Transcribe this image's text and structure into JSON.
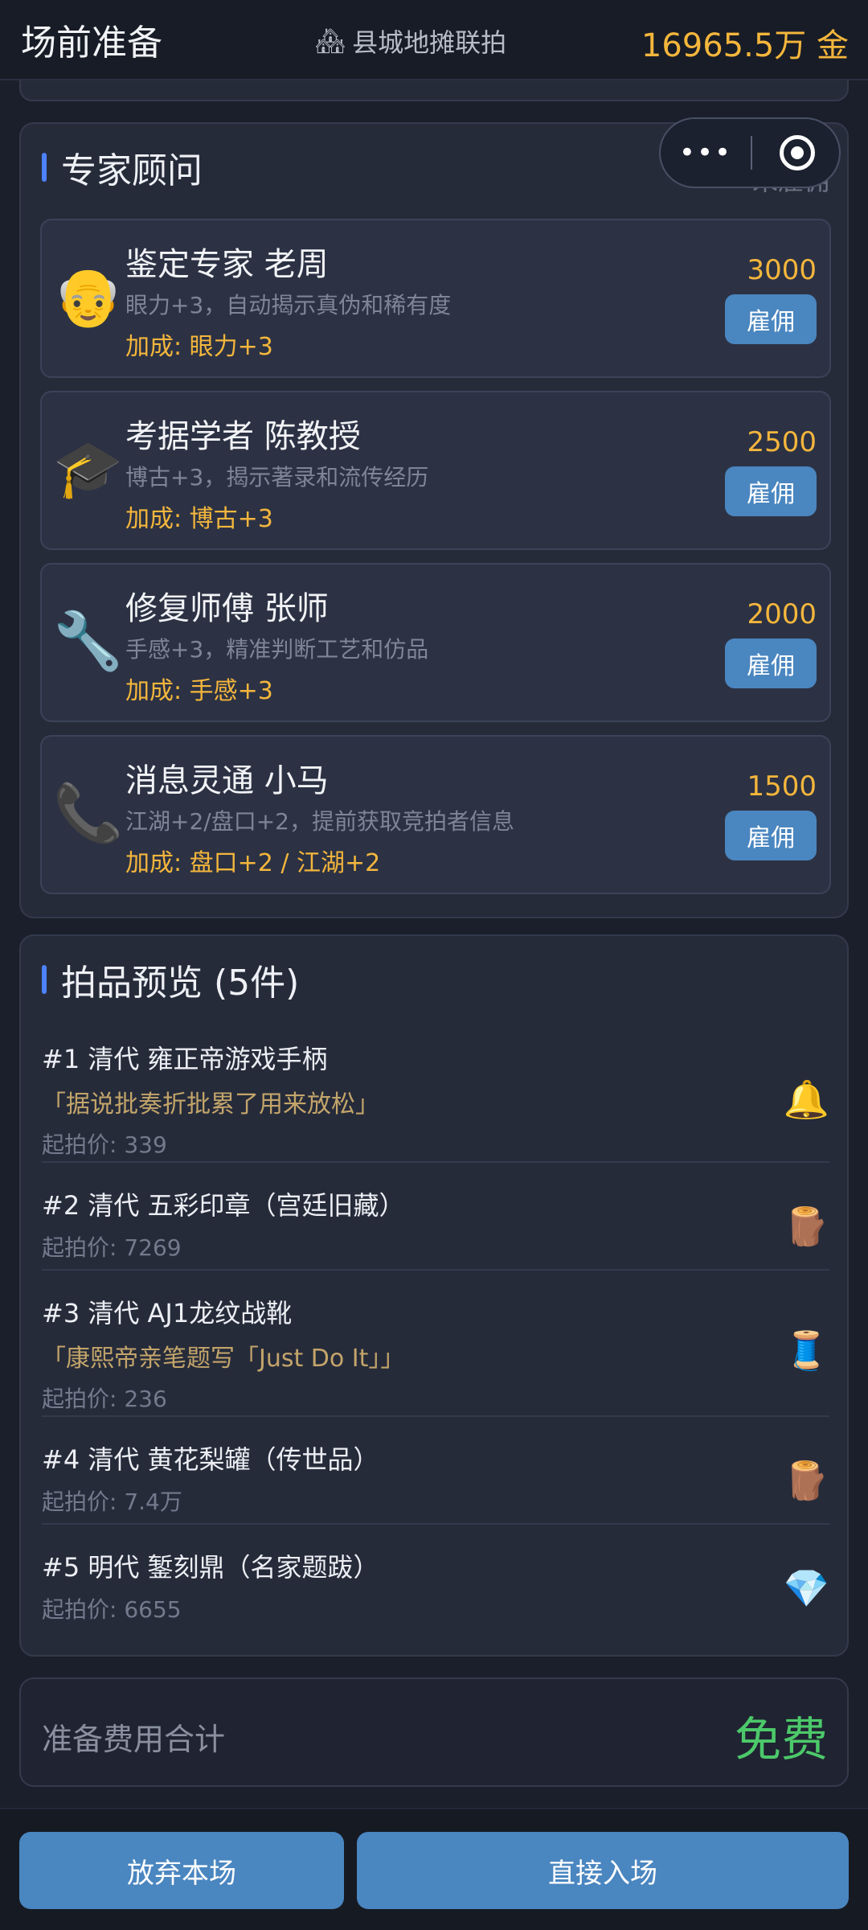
{
  "header": {
    "title": "场前准备",
    "location_icon": "house-icon",
    "location": "县城地摊联拍",
    "gold": "16965.5万 金"
  },
  "experts": {
    "title": "专家顾问",
    "status": "未雇佣",
    "items": [
      {
        "icon": "old-man-face-icon",
        "name": "鉴定专家 老周",
        "desc": "眼力+3，自动揭示真伪和稀有度",
        "bonus": "加成: 眼力+3",
        "price": "3000",
        "hire_label": "雇佣"
      },
      {
        "icon": "graduation-cap-icon",
        "name": "考据学者 陈教授",
        "desc": "博古+3，揭示著录和流传经历",
        "bonus": "加成: 博古+3",
        "price": "2500",
        "hire_label": "雇佣"
      },
      {
        "icon": "wrench-icon",
        "name": "修复师傅 张师",
        "desc": "手感+3，精准判断工艺和仿品",
        "bonus": "加成: 手感+3",
        "price": "2000",
        "hire_label": "雇佣"
      },
      {
        "icon": "telephone-icon",
        "name": "消息灵通 小马",
        "desc": "江湖+2/盘口+2，提前获取竞拍者信息",
        "bonus": "加成: 盘口+2 / 江湖+2",
        "price": "1500",
        "hire_label": "雇佣"
      }
    ]
  },
  "lots": {
    "title": "拍品预览 (5件)",
    "items": [
      {
        "title": "#1 清代 雍正帝游戏手柄",
        "quote": "「据说批奏折批累了用来放松」",
        "price": "起拍价: 339",
        "icon": "bell-icon"
      },
      {
        "title": "#2 清代 五彩印章（宫廷旧藏）",
        "quote": "",
        "price": "起拍价: 7269",
        "icon": "wood-log-icon"
      },
      {
        "title": "#3 清代 AJ1龙纹战靴",
        "quote": "「康熙帝亲笔题写「Just Do It」」",
        "price": "起拍价: 236",
        "icon": "thread-spool-icon"
      },
      {
        "title": "#4 清代 黄花梨罐（传世品）",
        "quote": "",
        "price": "起拍价: 7.4万",
        "icon": "wood-log-icon"
      },
      {
        "title": "#5 明代 錾刻鼎（名家题跋）",
        "quote": "",
        "price": "起拍价: 6655",
        "icon": "gem-icon"
      }
    ]
  },
  "total": {
    "label": "准备费用合计",
    "value": "免费"
  },
  "footer": {
    "abandon_label": "放弃本场",
    "enter_label": "直接入场"
  },
  "colors": {
    "accent": "#4a86c0",
    "gold": "#f4b63c",
    "free": "#4cc96a"
  }
}
